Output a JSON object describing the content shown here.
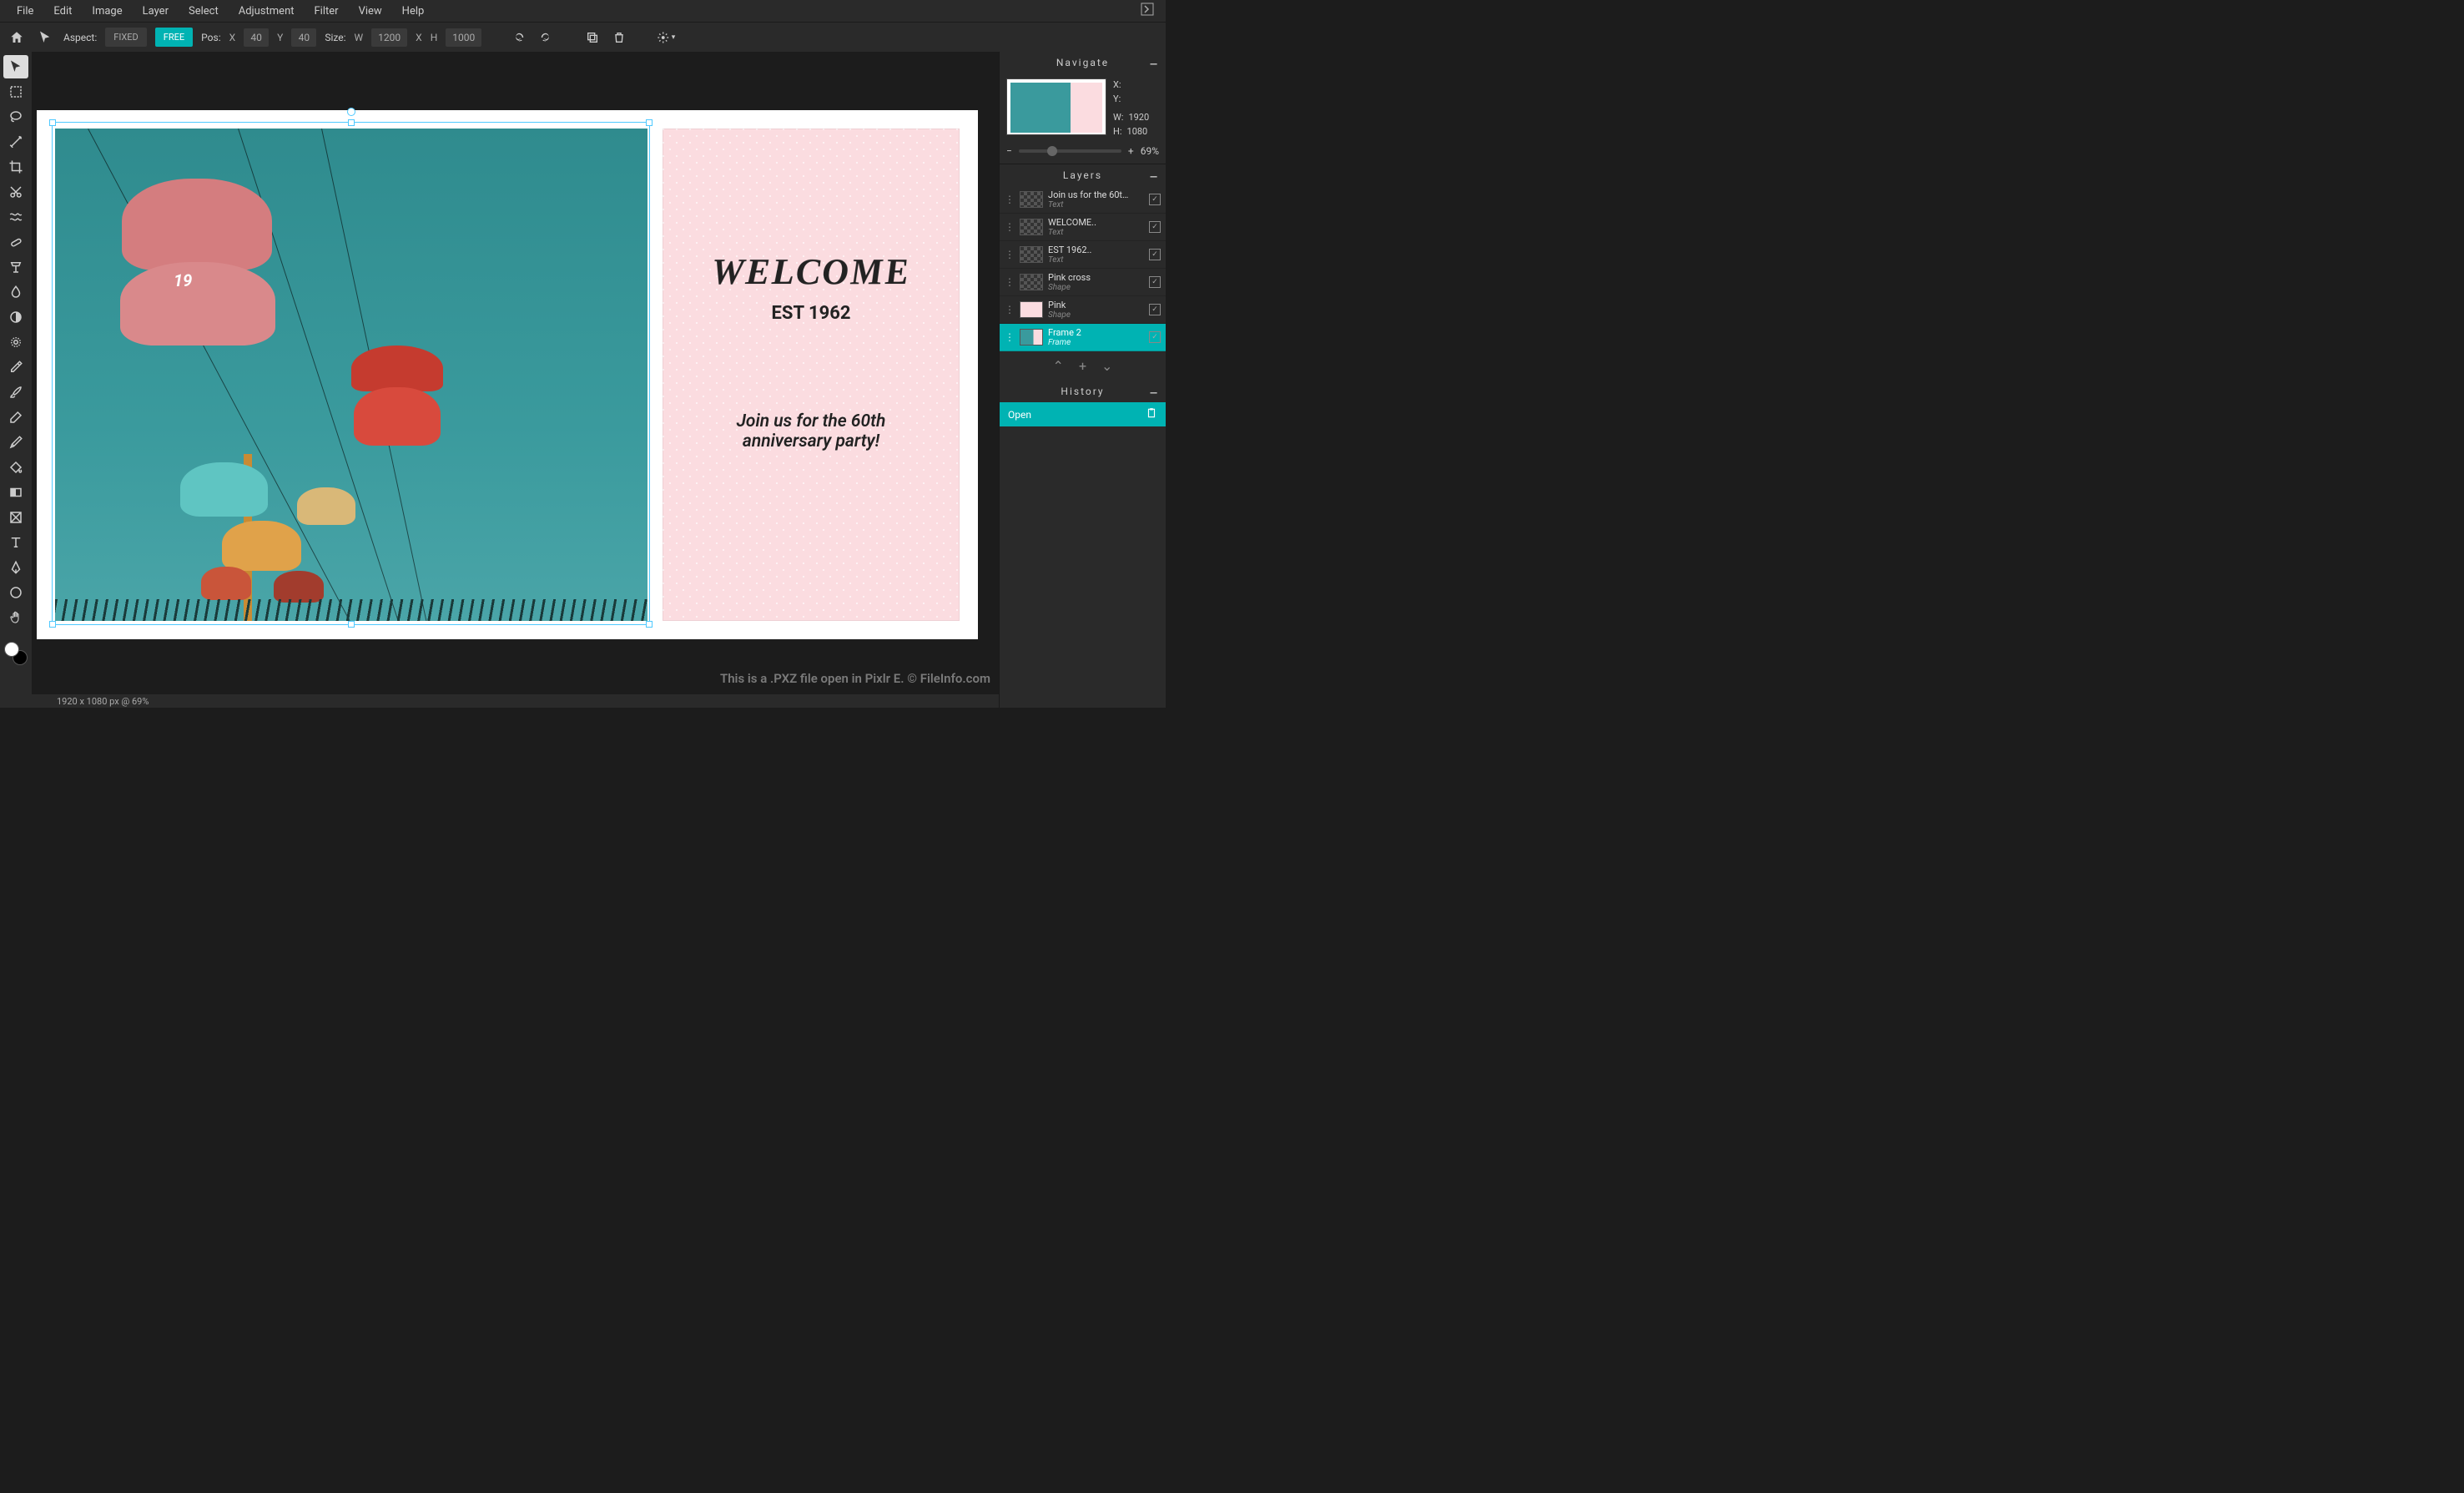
{
  "menubar": {
    "items": [
      "File",
      "Edit",
      "Image",
      "Layer",
      "Select",
      "Adjustment",
      "Filter",
      "View",
      "Help"
    ]
  },
  "optionbar": {
    "aspect_label": "Aspect:",
    "fixed": "FIXED",
    "free": "FREE",
    "pos_label": "Pos:",
    "x_label": "X",
    "y_label": "Y",
    "pos_x": "40",
    "pos_y": "40",
    "size_label": "Size:",
    "w_label": "W",
    "h_label": "H",
    "size_w": "1200",
    "size_mid": "X",
    "size_h": "1000"
  },
  "canvas": {
    "welcome": "WELCOME",
    "est": "EST 1962",
    "join": "Join us for the 60th anniversary party!",
    "car_num": "19",
    "footer_note": "This is a .PXZ file open in Pixlr E. © FileInfo.com"
  },
  "statusbar": {
    "text": "1920 x 1080 px @ 69%"
  },
  "navigate": {
    "title": "Navigate",
    "x_label": "X:",
    "y_label": "Y:",
    "w_label": "W:",
    "h_label": "H:",
    "w_val": "1920",
    "h_val": "1080",
    "zoom_minus": "−",
    "zoom_plus": "+",
    "zoom_pct": "69%"
  },
  "layers": {
    "title": "Layers",
    "items": [
      {
        "name": "Join us for the 60t…",
        "type": "Text",
        "thumb": "checker"
      },
      {
        "name": "WELCOME..",
        "type": "Text",
        "thumb": "checker"
      },
      {
        "name": "EST 1962..",
        "type": "Text",
        "thumb": "checker"
      },
      {
        "name": "Pink cross",
        "type": "Shape",
        "thumb": "checker"
      },
      {
        "name": "Pink",
        "type": "Shape",
        "thumb": "pink"
      },
      {
        "name": "Frame 2",
        "type": "Frame",
        "thumb": "frame",
        "selected": true
      }
    ],
    "action_up": "⌃",
    "action_add": "+",
    "action_down": "⌄"
  },
  "history": {
    "title": "History",
    "open": "Open"
  },
  "tools_semantic": [
    "arrow",
    "marquee",
    "lasso",
    "wand",
    "crop",
    "cut",
    "liquify",
    "heal",
    "clone",
    "blur",
    "dodge",
    "sponge",
    "eyedropper",
    "brush",
    "eraser",
    "pen",
    "fill",
    "gradient",
    "frame",
    "text",
    "draw",
    "shape",
    "hand"
  ]
}
